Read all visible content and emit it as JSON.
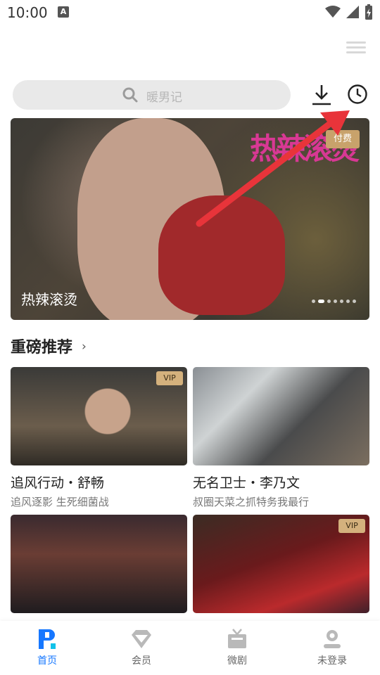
{
  "status": {
    "time": "10:00",
    "notif_letter": "A"
  },
  "search": {
    "placeholder": "暖男记"
  },
  "banner": {
    "title": "热辣滚烫",
    "badge": "付费",
    "logo_text": "热辣滚烫",
    "dots_total": 7,
    "active_dot": 1
  },
  "section": {
    "title": "重磅推荐",
    "chevron": "›"
  },
  "cards": [
    {
      "title": "追风行动・舒畅",
      "subtitle": "追风逐影 生死细菌战",
      "badge": "VIP"
    },
    {
      "title": "无名卫士・李乃文",
      "subtitle": "叔圈天菜之抓特务我最行",
      "badge": ""
    },
    {
      "title": "",
      "subtitle": "",
      "badge": ""
    },
    {
      "title": "",
      "subtitle": "",
      "badge": "VIP"
    }
  ],
  "nav": [
    {
      "label": "首页",
      "active": true
    },
    {
      "label": "会员",
      "active": false
    },
    {
      "label": "微剧",
      "active": false
    },
    {
      "label": "未登录",
      "active": false
    }
  ],
  "colors": {
    "accent": "#1677ff",
    "vip": "#d4b17d",
    "arrow": "#e8343a"
  }
}
